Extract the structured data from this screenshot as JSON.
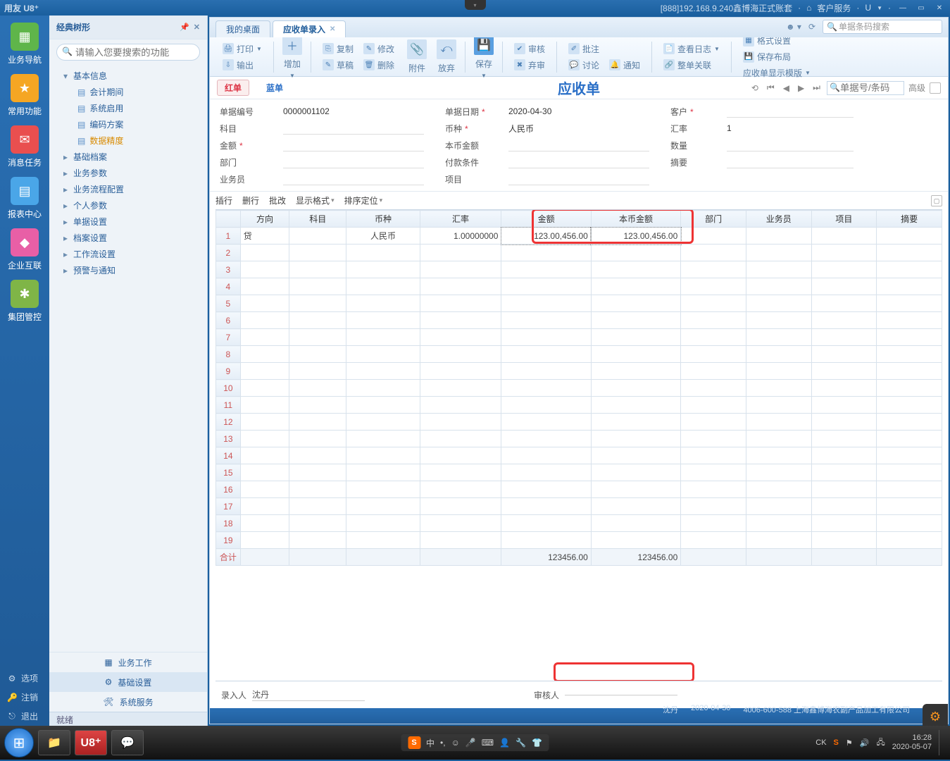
{
  "titlebar": {
    "app_name": "用友 U8⁺",
    "server_info": "[888]192.168.9.240鑫博海正式账套",
    "service_label": "客户服务",
    "u_label": "U"
  },
  "appbar": {
    "items": [
      {
        "label": "业务导航",
        "color": "#5fb54a"
      },
      {
        "label": "常用功能",
        "color": "#f5a623"
      },
      {
        "label": "消息任务",
        "color": "#e94f4f"
      },
      {
        "label": "报表中心",
        "color": "#4aa6e8"
      },
      {
        "label": "企业互联",
        "color": "#e85fa6"
      },
      {
        "label": "集团管控",
        "color": "#7fb547"
      }
    ],
    "bottom": [
      {
        "icon": "⚙",
        "label": "选项"
      },
      {
        "icon": "🔑",
        "label": "注销"
      },
      {
        "icon": "⎋",
        "label": "退出"
      }
    ]
  },
  "treepanel": {
    "title": "经典树形",
    "search_placeholder": "请输入您要搜索的功能",
    "root": "基本信息",
    "leaves": [
      "会计期间",
      "系统启用",
      "编码方案",
      "数据精度"
    ],
    "collapsed": [
      "基础档案",
      "业务参数",
      "业务流程配置",
      "个人参数",
      "单据设置",
      "档案设置",
      "工作流设置",
      "预警与通知"
    ],
    "bottom_tabs": [
      "业务工作",
      "基础设置",
      "系统服务"
    ]
  },
  "tabs": {
    "items": [
      "我的桌面",
      "应收单录入"
    ],
    "search_placeholder": "单据条码搜索"
  },
  "toolbar": {
    "print": "打印",
    "export": "输出",
    "add": "增加",
    "copy": "复制",
    "draft": "草稿",
    "modify": "修改",
    "delete": "删除",
    "attach": "附件",
    "abandon": "放弃",
    "save": "保存",
    "audit": "审核",
    "unaudit": "弃审",
    "note": "批注",
    "discuss": "讨论",
    "notify": "通知",
    "log": "查看日志",
    "link": "整单关联",
    "fmt": "格式设置",
    "layout": "保存布局",
    "template": "应收单显示模版"
  },
  "dochead": {
    "red": "红单",
    "blue": "蓝单",
    "title": "应收单",
    "search_placeholder": "单据号/条码",
    "adv": "高级"
  },
  "form": {
    "f1": {
      "lbl": "单据编号",
      "val": "0000001102"
    },
    "f2": {
      "lbl": "单据日期",
      "val": "2020-04-30",
      "req": true
    },
    "f3": {
      "lbl": "客户",
      "val": "",
      "req": true
    },
    "f4": {
      "lbl": "科目",
      "val": ""
    },
    "f5": {
      "lbl": "币种",
      "val": "人民币",
      "req": true
    },
    "f6": {
      "lbl": "汇率",
      "val": "1"
    },
    "f7": {
      "lbl": "金额",
      "val": "",
      "req": true
    },
    "f8": {
      "lbl": "本币金额",
      "val": ""
    },
    "f9": {
      "lbl": "数量",
      "val": ""
    },
    "f10": {
      "lbl": "部门",
      "val": ""
    },
    "f11": {
      "lbl": "付款条件",
      "val": ""
    },
    "f12": {
      "lbl": "摘要",
      "val": ""
    },
    "f13": {
      "lbl": "业务员",
      "val": ""
    },
    "f14": {
      "lbl": "项目",
      "val": ""
    }
  },
  "gridbar": {
    "insert": "插行",
    "delete": "删行",
    "batch": "批改",
    "disp": "显示格式",
    "sort": "排序定位"
  },
  "grid": {
    "cols": [
      "方向",
      "科目",
      "币种",
      "汇率",
      "金额",
      "本币金额",
      "部门",
      "业务员",
      "项目",
      "摘要"
    ],
    "row1": {
      "dir": "贷",
      "curr": "人民币",
      "rate": "1.00000000",
      "amt": "123.00,456.00",
      "bamt": "123.00,456.00"
    },
    "total_label": "合计",
    "total_amt": "123456.00",
    "total_bamt": "123456.00"
  },
  "footer": {
    "entry_lbl": "录入人",
    "entry_val": "沈丹",
    "audit_lbl": "审核人",
    "audit_val": ""
  },
  "statusbar": {
    "ready": "就绪",
    "user": "沈丹",
    "date": "2020-04-30",
    "hotline": "4006-600-588 上海鑫博海农副产品加工有限公司"
  },
  "taskbar": {
    "lang": "中",
    "tray_ck": "CK",
    "time": "16:28",
    "date": "2020-05-07"
  }
}
